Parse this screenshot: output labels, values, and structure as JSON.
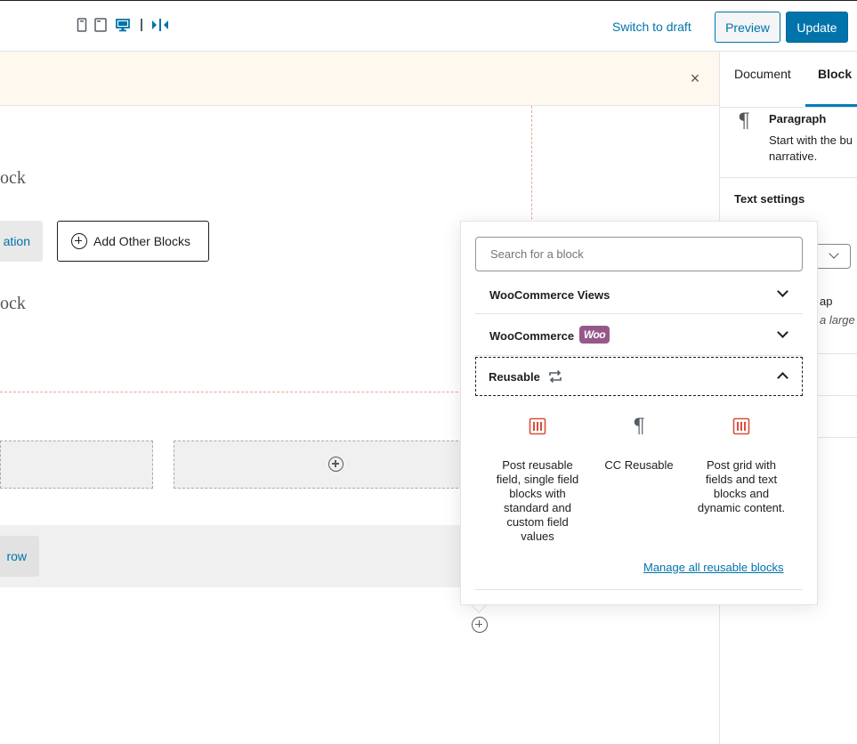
{
  "topbar": {
    "device_icons": [
      "mobile-preview-icon",
      "tablet-preview-icon",
      "desktop-preview-icon",
      "split-view-icon"
    ],
    "switch_to_draft": "Switch to draft",
    "preview": "Preview",
    "update": "Update"
  },
  "notice": {
    "close": "×"
  },
  "canvas": {
    "block_text_1": "ock",
    "block_text_2": "ock",
    "partial_button": "ation",
    "add_other_blocks": "Add Other Blocks",
    "row_button": "row"
  },
  "sidebar": {
    "tabs": [
      "Document",
      "Block"
    ],
    "active_tab": "Block",
    "block_title": "Paragraph",
    "block_desc_line1": "Start with the bu",
    "block_desc_line2": "narrative.",
    "text_settings": "Text settings",
    "drop_cap_label": "ap",
    "drop_cap_help": "a large"
  },
  "inserter": {
    "search_placeholder": "Search for a block",
    "panels": [
      {
        "title": "WooCommerce Views",
        "expanded": false
      },
      {
        "title": "WooCommerce",
        "badge": "Woo",
        "expanded": false
      },
      {
        "title": "Reusable",
        "expanded": true
      }
    ],
    "reusable_blocks": [
      {
        "icon": "grid-table-icon",
        "label": "Post reusable field, single field blocks with standard and custom field values"
      },
      {
        "icon": "pilcrow-icon",
        "label": "CC Reusable"
      },
      {
        "icon": "grid-table-icon",
        "label": "Post grid with fields and text blocks and dynamic content."
      }
    ],
    "manage_link": "Manage all reusable blocks"
  },
  "colors": {
    "accent": "#0073aa",
    "woo_purple": "#96588a",
    "grid_icon_red": "#d94f3d",
    "notice_bg": "#fef8ee"
  }
}
